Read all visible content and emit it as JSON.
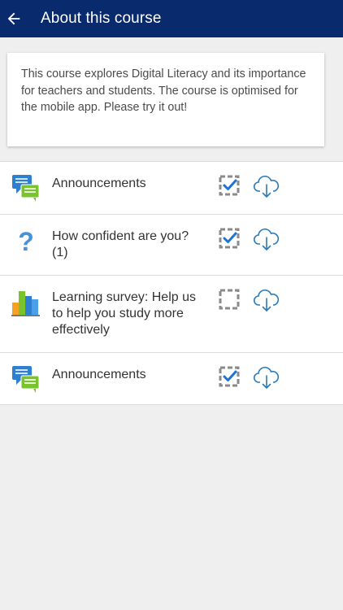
{
  "header": {
    "title": "About this course"
  },
  "summary": {
    "text": "This course explores Digital Literacy and its importance for teachers and students. The course is optimised for the mobile app. Please try it out!"
  },
  "modules": [
    {
      "label": "Announcements",
      "icon": "forum-icon",
      "completed": true
    },
    {
      "label": "How confident are you? (1)",
      "icon": "question-icon",
      "completed": true
    },
    {
      "label": "Learning survey: Help us to help you study more effectively",
      "icon": "survey-icon",
      "completed": false
    },
    {
      "label": "Announcements",
      "icon": "forum-icon",
      "completed": true
    }
  ],
  "colors": {
    "appbar": "#0a2a6e",
    "check": "#1e73d6",
    "download": "#2c7ab8"
  }
}
